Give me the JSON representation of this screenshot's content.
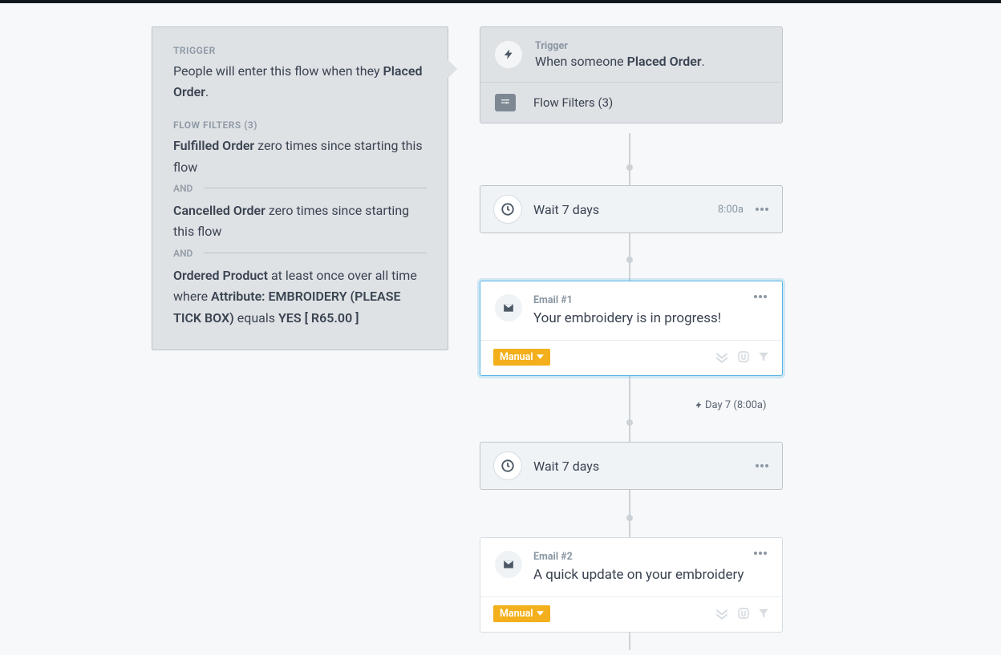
{
  "sidebar": {
    "triggerLabel": "TRIGGER",
    "triggerLinePrefix": "People will enter this flow when they ",
    "triggerEvent": "Placed Order",
    "filtersLabel": "FLOW FILTERS (3)",
    "filters": [
      {
        "bold0": "Fulfilled Order",
        "rest": " zero times since starting this flow"
      },
      {
        "bold0": "Cancelled Order",
        "rest": " zero times since starting this flow"
      },
      {
        "bold0": "Ordered Product",
        "mid": " at least once over all time where ",
        "bold1": "Attribute: EMBROIDERY (PLEASE TICK BOX)",
        "mid2": " equals ",
        "bold2": "YES [ R65.00 ]"
      }
    ],
    "andLabel": "AND"
  },
  "trigger": {
    "label": "Trigger",
    "textPrefix": "When someone ",
    "textBold": "Placed Order",
    "filtersText": "Flow Filters (3)"
  },
  "wait1": {
    "text": "Wait 7 days",
    "time": "8:00a"
  },
  "email1": {
    "label": "Email #1",
    "subject": "Your embroidery is in progress!",
    "status": "Manual"
  },
  "dayTag": "Day 7 (8:00a)",
  "wait2": {
    "text": "Wait 7 days"
  },
  "email2": {
    "label": "Email #2",
    "subject": "A quick update on your embroidery",
    "status": "Manual"
  }
}
